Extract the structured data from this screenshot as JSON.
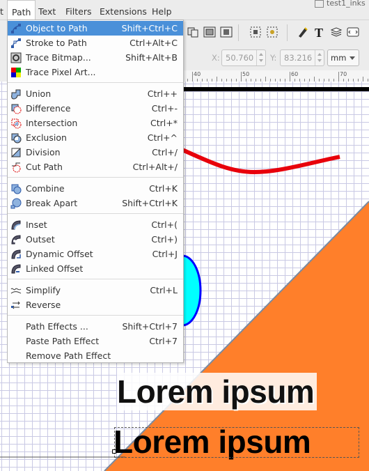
{
  "menubar": {
    "items": [
      {
        "label": "t",
        "name": "menu-edit-fragment"
      },
      {
        "label": "Path",
        "name": "menu-path"
      },
      {
        "label": "Text",
        "name": "menu-text"
      },
      {
        "label": "Filters",
        "name": "menu-filters"
      },
      {
        "label": "Extensions",
        "name": "menu-extensions"
      },
      {
        "label": "Help",
        "name": "menu-help"
      }
    ],
    "window_title_fragment": "test1_inks"
  },
  "path_menu": {
    "items": [
      {
        "label": "Object to Path",
        "shortcut": "Shift+Ctrl+C",
        "icon": "object-to-path-icon",
        "highlighted": true
      },
      {
        "label": "Stroke to Path",
        "shortcut": "Ctrl+Alt+C",
        "icon": "stroke-to-path-icon"
      },
      {
        "label": "Trace Bitmap...",
        "shortcut": "Shift+Alt+B",
        "icon": "trace-bitmap-icon"
      },
      {
        "label": "Trace Pixel Art...",
        "shortcut": "",
        "icon": "trace-pixel-art-icon"
      },
      {
        "label": "Union",
        "shortcut": "Ctrl++",
        "icon": "union-icon"
      },
      {
        "label": "Difference",
        "shortcut": "Ctrl+-",
        "icon": "difference-icon"
      },
      {
        "label": "Intersection",
        "shortcut": "Ctrl+*",
        "icon": "intersection-icon"
      },
      {
        "label": "Exclusion",
        "shortcut": "Ctrl+^",
        "icon": "exclusion-icon"
      },
      {
        "label": "Division",
        "shortcut": "Ctrl+/",
        "icon": "division-icon"
      },
      {
        "label": "Cut Path",
        "shortcut": "Ctrl+Alt+/",
        "icon": "cut-path-icon"
      },
      {
        "label": "Combine",
        "shortcut": "Ctrl+K",
        "icon": "combine-icon"
      },
      {
        "label": "Break Apart",
        "shortcut": "Shift+Ctrl+K",
        "icon": "break-apart-icon"
      },
      {
        "label": "Inset",
        "shortcut": "Ctrl+(",
        "icon": "inset-icon"
      },
      {
        "label": "Outset",
        "shortcut": "Ctrl+)",
        "icon": "outset-icon"
      },
      {
        "label": "Dynamic Offset",
        "shortcut": "Ctrl+J",
        "icon": "dynamic-offset-icon"
      },
      {
        "label": "Linked Offset",
        "shortcut": "",
        "icon": "linked-offset-icon"
      },
      {
        "label": "Simplify",
        "shortcut": "Ctrl+L",
        "icon": "simplify-icon"
      },
      {
        "label": "Reverse",
        "shortcut": "",
        "icon": "reverse-icon"
      },
      {
        "label": "Path Effects ...",
        "shortcut": "Shift+Ctrl+7",
        "icon": ""
      },
      {
        "label": "Paste Path Effect",
        "shortcut": "Ctrl+7",
        "icon": ""
      },
      {
        "label": "Remove Path Effect",
        "shortcut": "",
        "icon": ""
      }
    ]
  },
  "toolbar": {
    "x_label": "X:",
    "x_value": "50.760",
    "y_label": "Y:",
    "y_value": "83.216",
    "unit": "mm"
  },
  "ruler": {
    "labels": [
      "40",
      "50",
      "60",
      "70"
    ]
  },
  "canvas": {
    "text_1": "Lorem ipsum",
    "text_2": "Lorem ipsum"
  },
  "colors": {
    "accent": "#4a90d9",
    "orange": "#ff7f2a",
    "red_curve": "#e8000b",
    "cyan": "#00ffff",
    "blue_stroke": "#0000ff"
  }
}
